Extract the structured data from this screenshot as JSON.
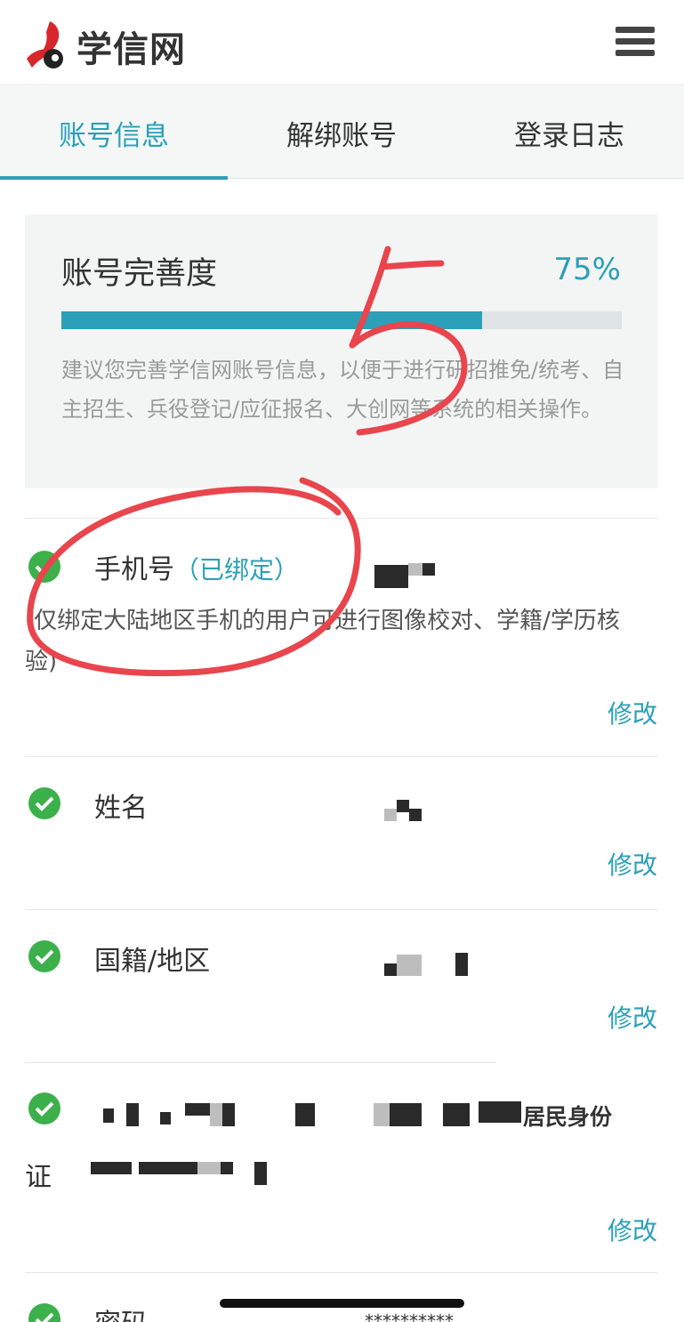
{
  "app": {
    "logo_text": "学信网",
    "menu_icon": "hamburger-menu-icon"
  },
  "tabs": [
    {
      "label": "账号信息",
      "active": true
    },
    {
      "label": "解绑账号",
      "active": false
    },
    {
      "label": "登录日志",
      "active": false
    }
  ],
  "completeness": {
    "title": "账号完善度",
    "percent_text": "75%",
    "progress": 0.75,
    "note": "建议您完善学信网账号信息，以便于进行研招推免/统考、自主招生、兵役登记/应征报名、大创网等系统的相关操作。"
  },
  "rows": {
    "phone": {
      "label": "手机号",
      "status": "（已绑定）",
      "desc": "(仅绑定大陆地区手机的用户可进行图像校对、学籍/学历核验)",
      "edit": "修改"
    },
    "name": {
      "label": "姓名",
      "edit": "修改"
    },
    "nationality": {
      "label": "国籍/地区",
      "edit": "修改"
    },
    "id_doc": {
      "label_tail": "居民身份",
      "label_wrap": "证",
      "edit": "修改"
    },
    "password": {
      "label": "密码",
      "value": "**********"
    }
  },
  "annotation": {
    "handwritten_number": "5"
  },
  "colors": {
    "accent": "#2ba0b8",
    "check_green": "#3cb04a",
    "marker_red": "#e8454d"
  }
}
